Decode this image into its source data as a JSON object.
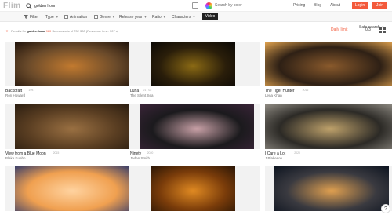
{
  "header": {
    "logo": "Flim",
    "search_query": "golden hour",
    "color_search_label": "Search by color",
    "nav": [
      "Pricing",
      "Blog",
      "About"
    ],
    "login_label": "Login",
    "join_label": "Join"
  },
  "filters": {
    "filter_label": "Filter",
    "type_label": "Type",
    "animation_label": "Animation",
    "genre_label": "Genre",
    "release_year_label": "Release year",
    "ratio_label": "Ratio",
    "characters_label": "Characters",
    "tooltip": "Video",
    "safe_search_label": "Safe search"
  },
  "results": {
    "prefix": "Results for",
    "query": "golden hour",
    "count": "960",
    "suffix": "Screenshots of 732 300 (Response time: 307 s)",
    "daily_limit_label": "Daily limit",
    "page_count": "0/3"
  },
  "cards": [
    {
      "title": "Backdraft",
      "time": "1991",
      "sub": "Ron Howard",
      "colors": [
        "#1e120a",
        "#c27a2f",
        "#6a4a2a"
      ]
    },
    {
      "title": "Luna",
      "time": "01 · 02",
      "sub": "The Silent Sea",
      "colors": [
        "#0a0805",
        "#8b6a14",
        "#2a1e0a"
      ]
    },
    {
      "title": "The Tiger Hunter",
      "time": "2016",
      "sub": "Lena Khan",
      "colors": [
        "#e6a650",
        "#8a5a2c",
        "#2e2015"
      ]
    },
    {
      "title": "View from a Blue Moon",
      "time": "2015",
      "sub": "Blake Kuehn",
      "colors": [
        "#2b1d10",
        "#9a7042",
        "#5a3e22"
      ]
    },
    {
      "title": "Ninety",
      "time": "2020",
      "sub": "Jaden Smith",
      "colors": [
        "#3a2438",
        "#c9a1a7",
        "#1b1a1d"
      ]
    },
    {
      "title": "I Care a Lot",
      "time": "2020",
      "sub": "J Blakeson",
      "colors": [
        "#8f8b83",
        "#bfa26b",
        "#2c2a26"
      ]
    },
    {
      "title": "",
      "time": "",
      "sub": "",
      "colors": [
        "#3a3f6a",
        "#ffd3a0",
        "#f0a050"
      ]
    },
    {
      "title": "",
      "time": "",
      "sub": "",
      "colors": [
        "#2a1606",
        "#e08a22",
        "#7a3c0a"
      ]
    },
    {
      "title": "",
      "time": "",
      "sub": "",
      "colors": [
        "#0d1420",
        "#e0a050",
        "#3a3a40"
      ]
    }
  ],
  "help_label": "?"
}
